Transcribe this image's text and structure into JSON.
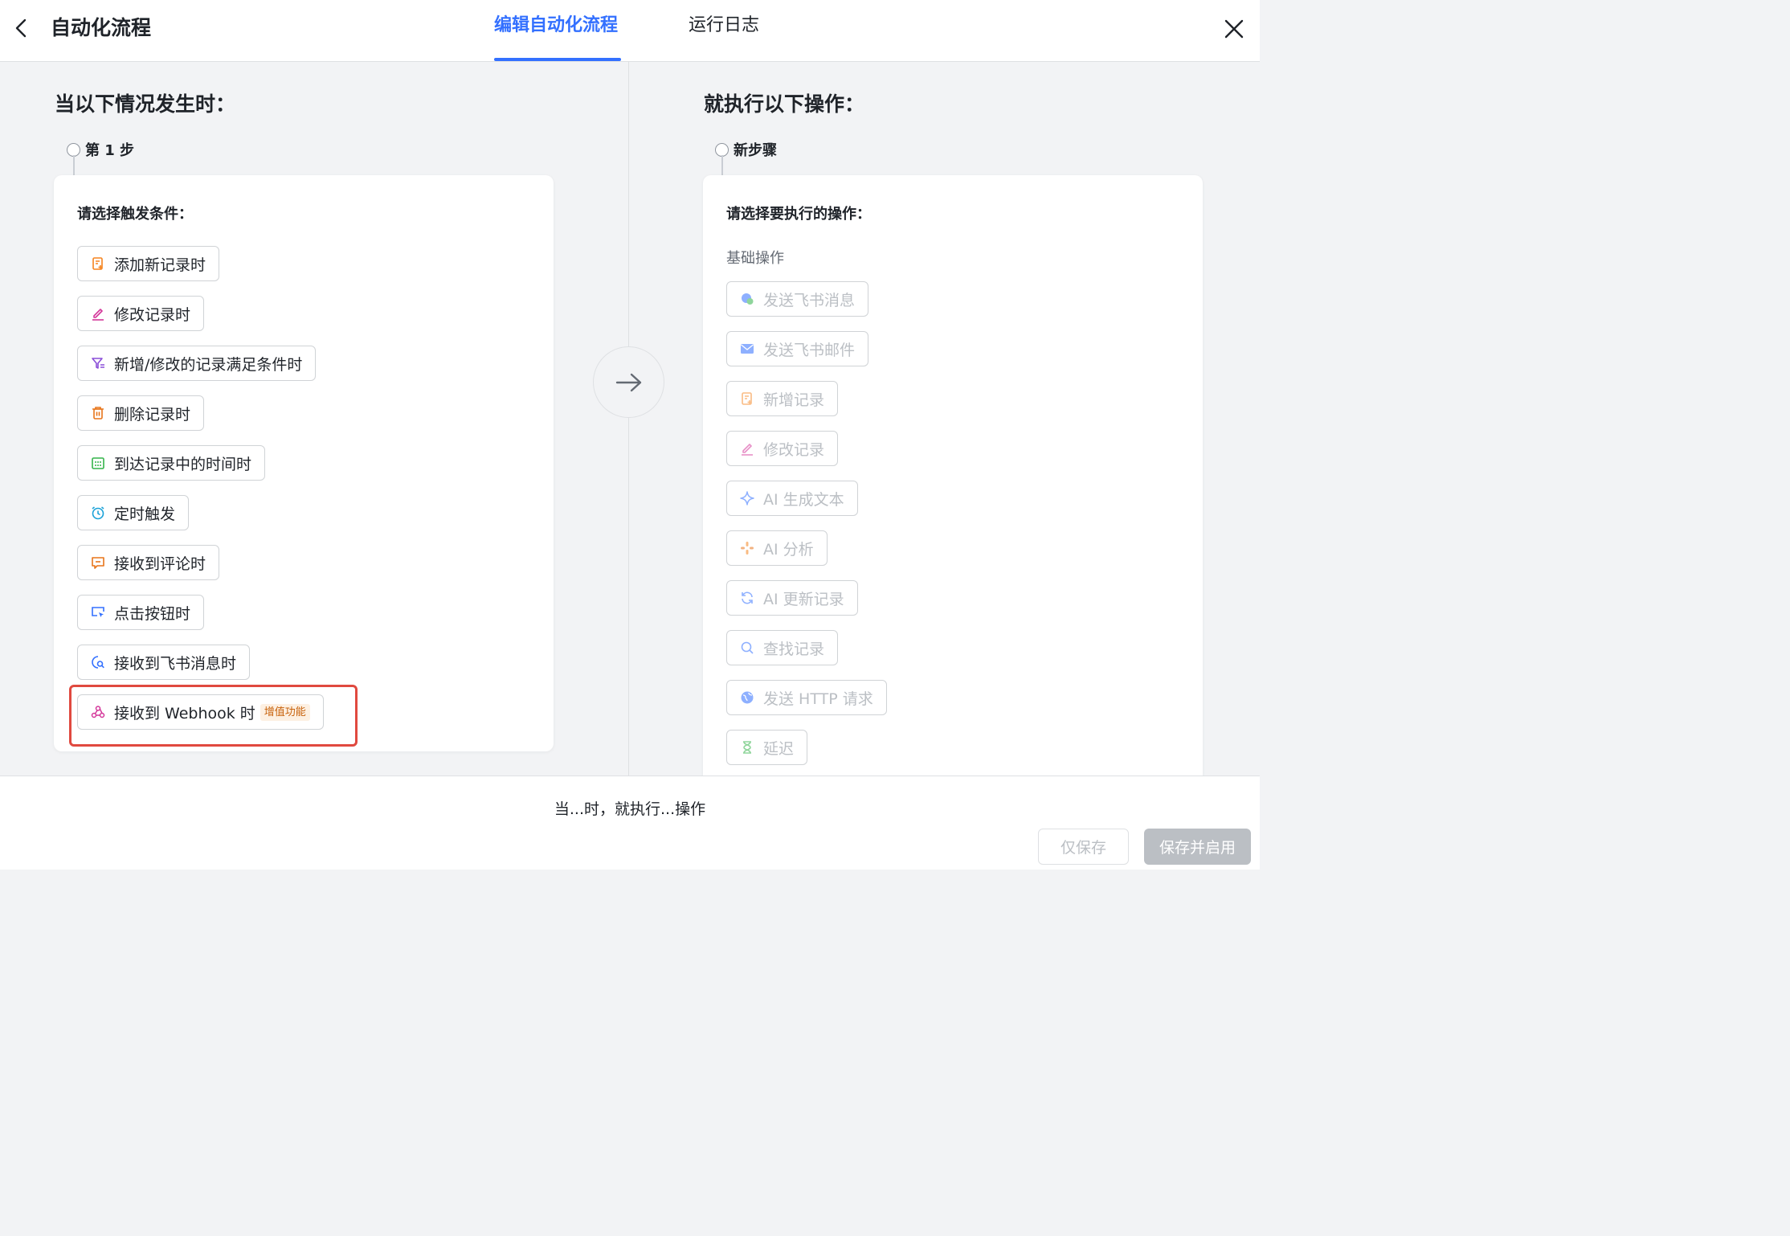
{
  "header": {
    "title": "自动化流程",
    "tabs": [
      {
        "label": "编辑自动化流程",
        "active": true
      },
      {
        "label": "运行日志",
        "active": false
      }
    ]
  },
  "trigger": {
    "section_title": "当以下情况发生时：",
    "step_label": "第 1 步",
    "heading": "请选择触发条件：",
    "options": [
      {
        "label": "添加新记录时",
        "icon": "record-add-icon"
      },
      {
        "label": "修改记录时",
        "icon": "edit-icon"
      },
      {
        "label": "新增/修改的记录满足条件时",
        "icon": "filter-icon"
      },
      {
        "label": "删除记录时",
        "icon": "trash-icon"
      },
      {
        "label": "到达记录中的时间时",
        "icon": "calendar-icon"
      },
      {
        "label": "定时触发",
        "icon": "alarm-clock-icon"
      },
      {
        "label": "接收到评论时",
        "icon": "comment-icon"
      },
      {
        "label": "点击按钮时",
        "icon": "button-cursor-icon"
      },
      {
        "label": "接收到飞书消息时",
        "icon": "chat-search-icon"
      },
      {
        "label": "接收到 Webhook 时",
        "icon": "webhook-icon",
        "badge": "增值功能"
      }
    ]
  },
  "action": {
    "section_title": "就执行以下操作：",
    "step_label": "新步骤",
    "heading": "请选择要执行的操作：",
    "group_title": "基础操作",
    "options": [
      {
        "label": "发送飞书消息",
        "icon": "chat-bubble-icon"
      },
      {
        "label": "发送飞书邮件",
        "icon": "mail-icon"
      },
      {
        "label": "新增记录",
        "icon": "record-add-icon"
      },
      {
        "label": "修改记录",
        "icon": "edit-icon"
      },
      {
        "label": "AI 生成文本",
        "icon": "sparkle-icon"
      },
      {
        "label": "AI 分析",
        "icon": "ai-analysis-icon"
      },
      {
        "label": "AI 更新记录",
        "icon": "refresh-icon"
      },
      {
        "label": "查找记录",
        "icon": "search-icon"
      },
      {
        "label": "发送 HTTP 请求",
        "icon": "globe-icon"
      },
      {
        "label": "延迟",
        "icon": "hourglass-icon"
      }
    ]
  },
  "footer": {
    "summary": "当...时，就执行...操作",
    "save_only_label": "仅保存",
    "save_enable_label": "保存并启用"
  },
  "colors": {
    "accent": "#3370ff",
    "highlight": "#e0493f",
    "badge_text": "#c8620c"
  }
}
